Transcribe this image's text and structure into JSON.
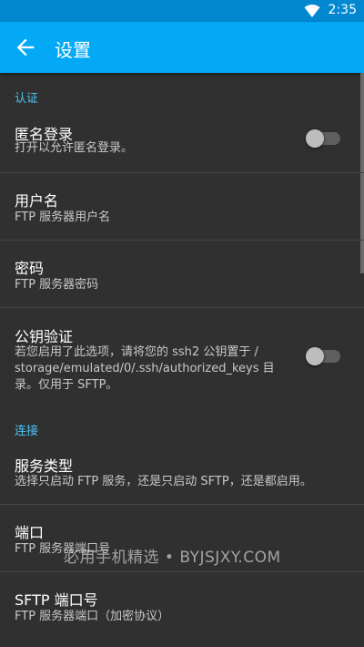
{
  "status_bar": {
    "time": "2:35"
  },
  "app_bar": {
    "title": "设置"
  },
  "sections": {
    "auth": "认证",
    "connection": "连接"
  },
  "items": {
    "anonymous": {
      "title": "匿名登录",
      "subtitle": "打开以允许匿名登录。",
      "switch_on": false
    },
    "username": {
      "title": "用户名",
      "subtitle": "FTP 服务器用户名"
    },
    "password": {
      "title": "密码",
      "subtitle": "FTP 服务器密码"
    },
    "pubkey": {
      "title": "公钥验证",
      "subtitle_line1": "若您启用了此选项，请将您的 ssh2 公钥置于 /",
      "subtitle_line2": "storage/emulated/0/.ssh/authorized_keys 目",
      "subtitle_line3": "录。仅用于 SFTP。",
      "switch_on": false
    },
    "service_type": {
      "title": "服务类型",
      "subtitle": "选择只启动 FTP 服务，还是只启动 SFTP，还是都启用。"
    },
    "port": {
      "title": "端口",
      "subtitle": "FTP 服务器端口号"
    },
    "sftp_port": {
      "title": "SFTP 端口号",
      "subtitle": "FTP 服务器端口（加密协议）"
    }
  },
  "watermark": "必用手机精选 • BYJSJXY.COM"
}
